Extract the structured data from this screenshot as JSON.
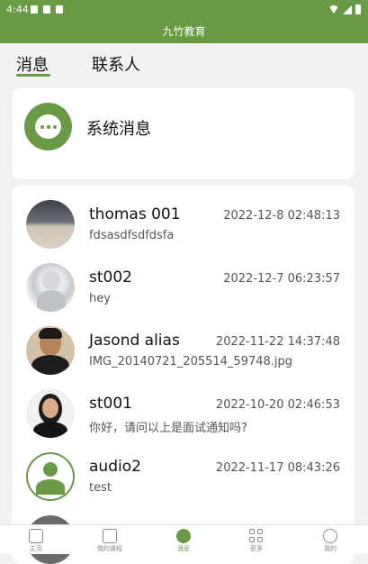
{
  "status_bar": {
    "time": "4:44"
  },
  "app_bar": {
    "title": "九竹教育"
  },
  "tabs": [
    {
      "label": "消息",
      "active": true
    },
    {
      "label": "联系人",
      "active": false
    }
  ],
  "system_messages": {
    "label": "系统消息"
  },
  "conversations": [
    {
      "name": "thomas 001",
      "time": "2022-12-8 02:48:13",
      "preview": "fdsasdfsdfdsfa"
    },
    {
      "name": "st002",
      "time": "2022-12-7 06:23:57",
      "preview": "hey"
    },
    {
      "name": "Jasond alias",
      "time": "2022-11-22 14:37:48",
      "preview": "IMG_20140721_205514_59748.jpg"
    },
    {
      "name": "st001",
      "time": "2022-10-20 02:46:53",
      "preview": "你好，请问以上是面试通知吗?"
    },
    {
      "name": "audio2",
      "time": "2022-11-17 08:43:26",
      "preview": "test"
    }
  ],
  "bottom_nav": [
    {
      "label": "主页",
      "icon": "home-icon"
    },
    {
      "label": "我的课程",
      "icon": "courses-icon"
    },
    {
      "label": "消息",
      "icon": "message-icon",
      "active": true
    },
    {
      "label": "更多",
      "icon": "grid-icon"
    },
    {
      "label": "我的",
      "icon": "profile-icon"
    }
  ],
  "colors": {
    "primary": "#6a9a46",
    "background": "#f2f2f2"
  }
}
